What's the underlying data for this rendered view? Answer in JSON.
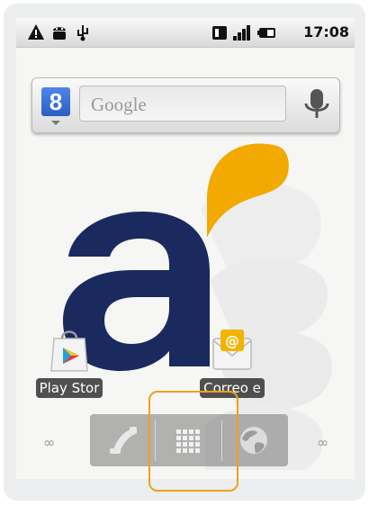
{
  "status_bar": {
    "time": "17:08",
    "left_icons": [
      "warning-icon",
      "android-debug-icon",
      "usb-icon"
    ],
    "right_icons": [
      "vibrate-icon",
      "signal-icon",
      "battery-icon"
    ]
  },
  "search_widget": {
    "placeholder": "Google",
    "google_button_label": "8"
  },
  "wallpaper": {
    "logo_letter": "a",
    "logo_color": "#1b2a5e",
    "accent_color": "#f2a900"
  },
  "apps": [
    {
      "label": "Play Stor",
      "icon": "play-store-icon"
    },
    {
      "label": "Correo e",
      "icon": "email-icon"
    }
  ],
  "dock": {
    "left_indicator": "∞",
    "right_indicator": "∞",
    "buttons": [
      "phone-icon",
      "app-drawer-icon",
      "browser-icon"
    ]
  },
  "colors": {
    "highlight": "#f0a01a",
    "status_bar_bg": "#e6e6e6"
  }
}
